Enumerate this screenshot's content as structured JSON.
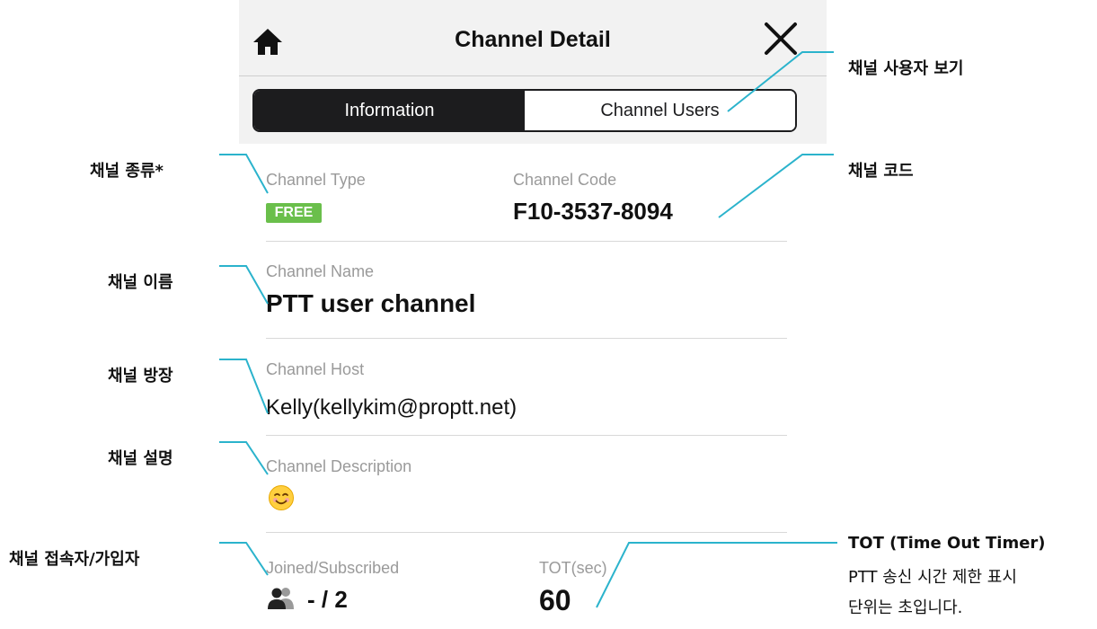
{
  "header": {
    "title": "Channel Detail",
    "tabs": [
      {
        "label": "Information",
        "active": true
      },
      {
        "label": "Channel Users",
        "active": false
      }
    ]
  },
  "fields": {
    "channel_type": {
      "label": "Channel Type",
      "badge": "FREE"
    },
    "channel_code": {
      "label": "Channel Code",
      "value": "F10-3537-8094"
    },
    "channel_name": {
      "label": "Channel Name",
      "value": "PTT user channel"
    },
    "channel_host": {
      "label": "Channel Host",
      "value": "Kelly(kellykim@proptt.net)"
    },
    "channel_description": {
      "label": "Channel Description",
      "value": "😊"
    },
    "joined": {
      "label": "Joined/Subscribed",
      "value": "- / 2"
    },
    "tot": {
      "label": "TOT(sec)",
      "value": "60"
    }
  },
  "annotations": {
    "channel_users": "채널 사용자 보기",
    "channel_type": "채널 종류*",
    "channel_code": "채널 코드",
    "channel_name": "채널 이름",
    "channel_host": "채널 방장",
    "channel_description": "채널 설명",
    "joined": "채널 접속자/가입자",
    "tot_title": "TOT (Time Out Timer)",
    "tot_note_line1": "PTT 송신 시간 제한 표시",
    "tot_note_line2": "단위는 초입니다."
  },
  "colors": {
    "accent_line": "#2bb3cc",
    "badge_green": "#6abf4b",
    "segment_dark": "#1c1c1e"
  },
  "icons": {
    "home": "home-icon",
    "close": "close-icon",
    "users": "users-icon",
    "smile": "smiley-face-icon"
  }
}
